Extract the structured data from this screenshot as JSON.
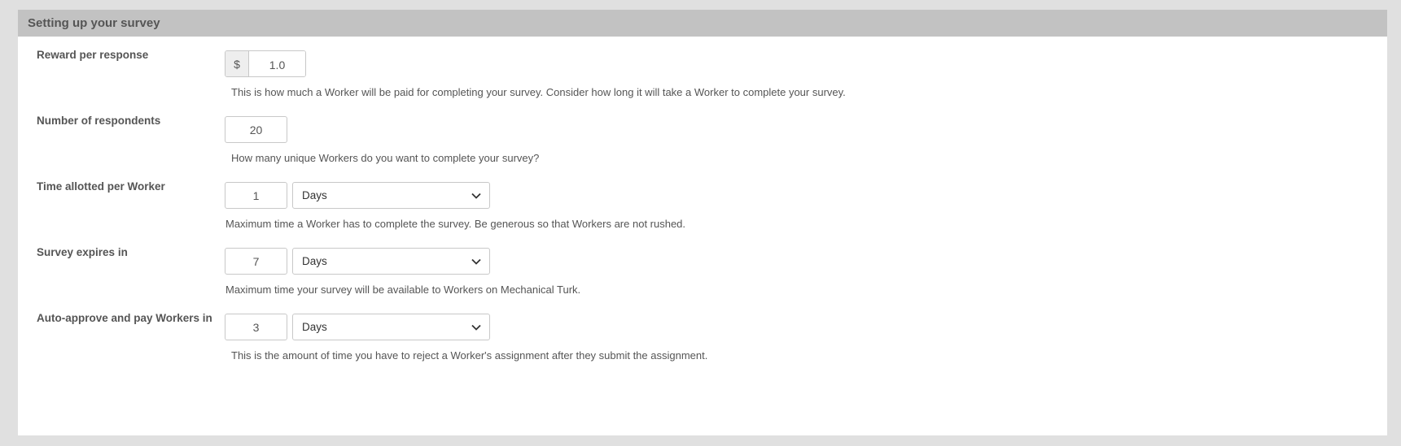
{
  "panel": {
    "title": "Setting up your survey"
  },
  "fields": {
    "reward": {
      "label": "Reward per response",
      "currency_symbol": "$",
      "value": "1.0",
      "help": "This is how much a Worker will be paid for completing your survey. Consider how long it will take a Worker to complete your survey."
    },
    "respondents": {
      "label": "Number of respondents",
      "value": "20",
      "help": "How many unique Workers do you want to complete your survey?"
    },
    "time_allotted": {
      "label": "Time allotted per Worker",
      "value": "1",
      "unit": "Days",
      "help": "Maximum time a Worker has to complete the survey. Be generous so that Workers are not rushed."
    },
    "expires": {
      "label": "Survey expires in",
      "value": "7",
      "unit": "Days",
      "help": "Maximum time your survey will be available to Workers on Mechanical Turk."
    },
    "auto_approve": {
      "label": "Auto-approve and pay Workers in",
      "value": "3",
      "unit": "Days",
      "help": "This is the amount of time you have to reject a Worker's assignment after they submit the assignment."
    }
  }
}
